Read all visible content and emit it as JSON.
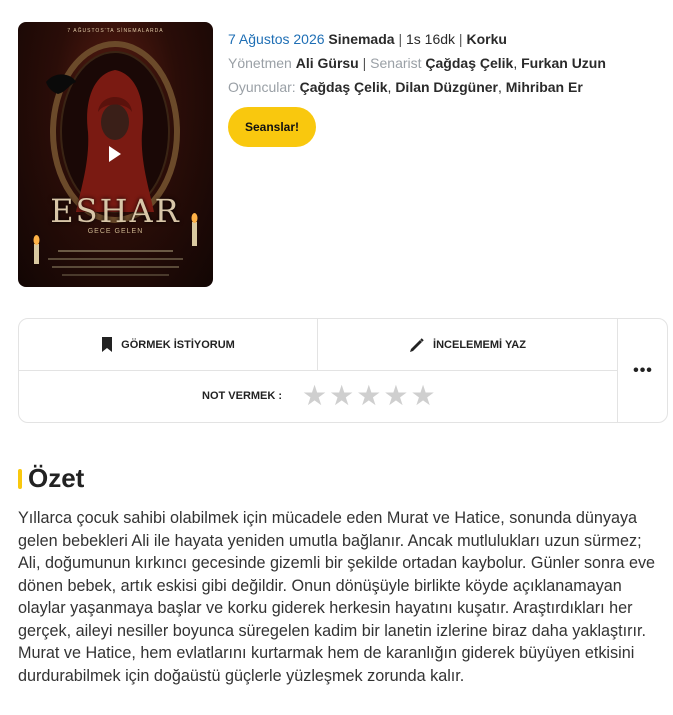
{
  "poster": {
    "tagline": "7 AĞUSTOS'TA SİNEMALARDA",
    "title": "ESHAR",
    "subtitle": "GECE GELEN"
  },
  "info": {
    "date": "7 Ağustos 2026",
    "release_place": "Sinemada",
    "duration": "1s 16dk",
    "genre": "Korku",
    "director_label": "Yönetmen",
    "director": "Ali Gürsu",
    "writer_label": "Senarist",
    "writers": [
      "Çağdaş Çelik",
      "Furkan Uzun"
    ],
    "cast_label": "Oyuncular:",
    "cast": [
      "Çağdaş Çelik",
      "Dilan Düzgüner",
      "Mihriban Er"
    ]
  },
  "buttons": {
    "showtimes": "Seanslar!",
    "want_to_watch": "GÖRMEK İSTİYORUM",
    "write_review": "İNCELEMEMİ YAZ",
    "more": "•••"
  },
  "rating": {
    "label": "NOT VERMEK :",
    "max_stars": 5,
    "value": 0
  },
  "summary": {
    "title": "Özet",
    "text": "Yıllarca çocuk sahibi olabilmek için mücadele eden Murat ve Hatice, sonunda dünyaya gelen bebekleri Ali ile hayata yeniden umutla bağlanır. Ancak mutlulukları uzun sürmez; Ali, doğumunun kırkıncı gecesinde gizemli bir şekilde ortadan kaybolur. Günler sonra eve dönen bebek, artık eskisi gibi değildir. Onun dönüşüyle birlikte köyde açıklanamayan olaylar yaşanmaya başlar ve korku giderek herkesin hayatını kuşatır. Araştırdıkları her gerçek, aileyi nesiller boyunca süregelen kadim bir lanetin izlerine biraz daha yaklaştırır. Murat ve Hatice, hem evlatlarını kurtarmak hem de karanlığın giderek büyüyen etkisini durdurabilmek için doğaüstü güçlerle yüzleşmek zorunda kalır."
  },
  "colors": {
    "accent": "#f9c80e",
    "link_blue": "#1f6fb5",
    "muted": "#9aa0a6",
    "star_empty": "#cfcfcf"
  }
}
